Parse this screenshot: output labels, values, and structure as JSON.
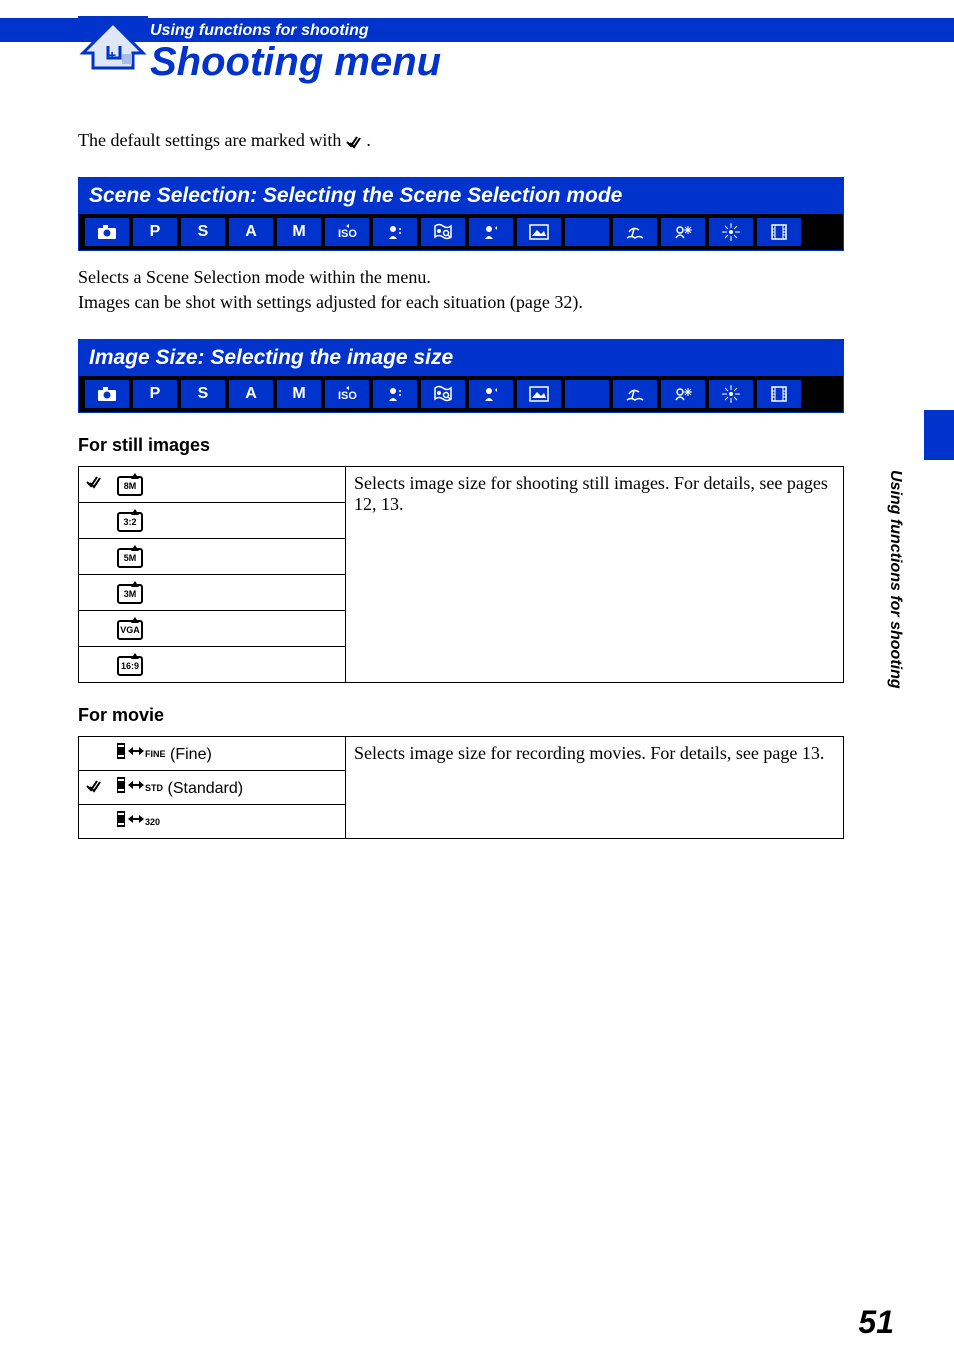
{
  "header": {
    "category": "Using functions for shooting",
    "title": "Shooting menu"
  },
  "intro": "The default settings are marked with ",
  "intro_suffix": ".",
  "sections": [
    {
      "title": "Scene Selection: Selecting the Scene Selection mode",
      "desc_lines": [
        "Selects a Scene Selection mode within the menu.",
        "Images can be shot with settings adjusted for each situation (page 32)."
      ]
    },
    {
      "title": "Image Size: Selecting the image size"
    }
  ],
  "mode_icons": [
    "camera",
    "P",
    "S",
    "A",
    "M",
    "iso",
    "hi-sens",
    "magnify",
    "portrait",
    "landscape",
    "moon",
    "beach",
    "snow",
    "fireworks",
    "film"
  ],
  "still_heading": "For still images",
  "still_table": {
    "options": [
      {
        "label": "8M",
        "default": true
      },
      {
        "label": "3:2",
        "default": false
      },
      {
        "label": "5M",
        "default": false
      },
      {
        "label": "3M",
        "default": false
      },
      {
        "label": "VGA",
        "default": false
      },
      {
        "label": "16:9",
        "default": false
      }
    ],
    "desc": "Selects image size for shooting still images. For details, see pages 12, 13."
  },
  "movie_heading": "For movie",
  "movie_table": {
    "options": [
      {
        "sub": "FINE",
        "label": "(Fine)",
        "default": false
      },
      {
        "sub": "STD",
        "label": "(Standard)",
        "default": true
      },
      {
        "sub": "320",
        "label": "",
        "default": false
      }
    ],
    "desc": "Selects image size for recording movies. For details, see page 13."
  },
  "side_label": "Using functions for shooting",
  "page_number": "51"
}
